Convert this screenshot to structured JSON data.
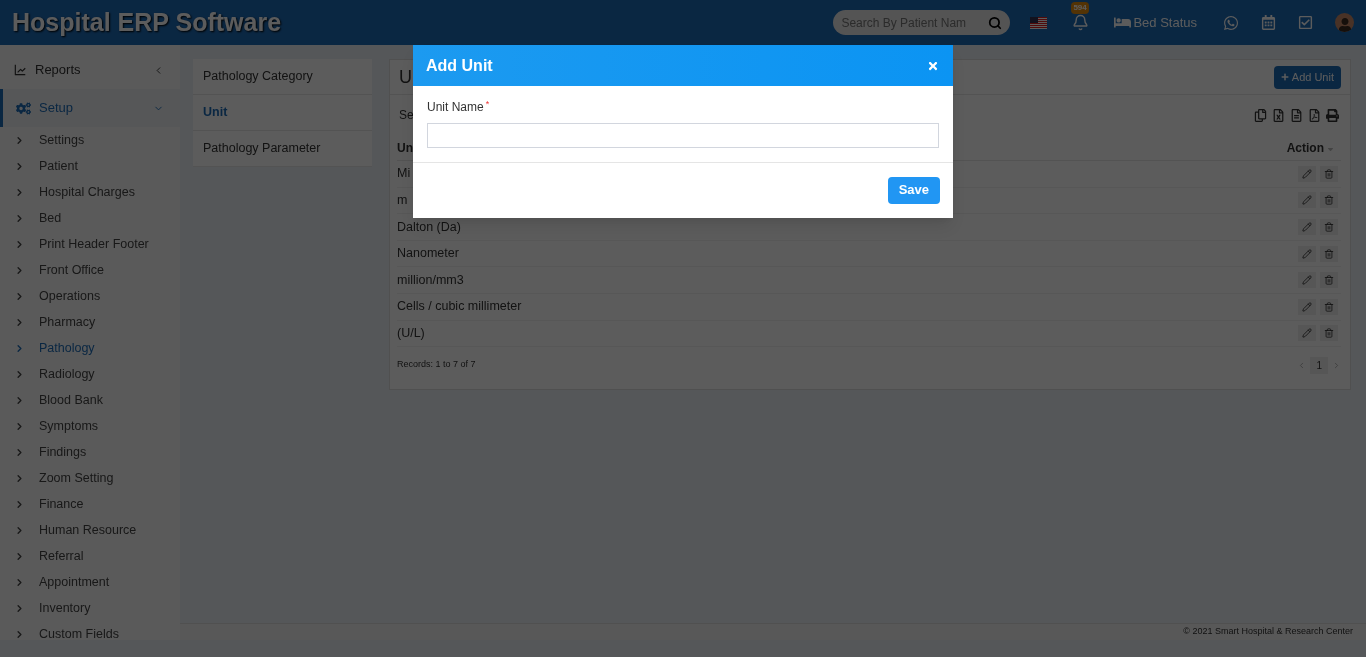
{
  "header": {
    "title": "Hospital ERP Software",
    "search": {
      "placeholder": "Search By Patient Nam"
    },
    "notification_count": "594",
    "bed_status": "Bed Status"
  },
  "sidebar": {
    "items": [
      {
        "label": "Reports",
        "kind": "group",
        "selected": false,
        "expanded": false
      },
      {
        "label": "Setup",
        "kind": "group",
        "selected": true,
        "expanded": true,
        "children": [
          {
            "label": "Settings",
            "selected": false
          },
          {
            "label": "Patient",
            "selected": false
          },
          {
            "label": "Hospital Charges",
            "selected": false
          },
          {
            "label": "Bed",
            "selected": false
          },
          {
            "label": "Print Header Footer",
            "selected": false
          },
          {
            "label": "Front Office",
            "selected": false
          },
          {
            "label": "Operations",
            "selected": false
          },
          {
            "label": "Pharmacy",
            "selected": false
          },
          {
            "label": "Pathology",
            "selected": true
          },
          {
            "label": "Radiology",
            "selected": false
          },
          {
            "label": "Blood Bank",
            "selected": false
          },
          {
            "label": "Symptoms",
            "selected": false
          },
          {
            "label": "Findings",
            "selected": false
          },
          {
            "label": "Zoom Setting",
            "selected": false
          },
          {
            "label": "Finance",
            "selected": false
          },
          {
            "label": "Human Resource",
            "selected": false
          },
          {
            "label": "Referral",
            "selected": false
          },
          {
            "label": "Appointment",
            "selected": false
          },
          {
            "label": "Inventory",
            "selected": false
          },
          {
            "label": "Custom Fields",
            "selected": false
          }
        ]
      }
    ]
  },
  "submenu": [
    {
      "label": "Pathology Category",
      "selected": false
    },
    {
      "label": "Unit",
      "selected": true
    },
    {
      "label": "Pathology Parameter",
      "selected": false
    }
  ],
  "card": {
    "title": "U",
    "add_button": "Add Unit",
    "search_label": "Se",
    "table": {
      "columns": [
        "Un",
        "Action"
      ],
      "rows": [
        [
          "Mi"
        ],
        [
          "m"
        ],
        [
          "Dalton (Da)"
        ],
        [
          "Nanometer"
        ],
        [
          "million/mm3"
        ],
        [
          "Cells / cubic millimeter"
        ],
        [
          "(U/L)"
        ]
      ]
    },
    "records": "Records: 1 to 7 of 7",
    "pages": [
      "1"
    ]
  },
  "footer": "© 2021 Smart Hospital & Research Center",
  "modal": {
    "title": "Add Unit",
    "field": {
      "label": "Unit Name",
      "required_mark": "*"
    },
    "save": "Save"
  }
}
